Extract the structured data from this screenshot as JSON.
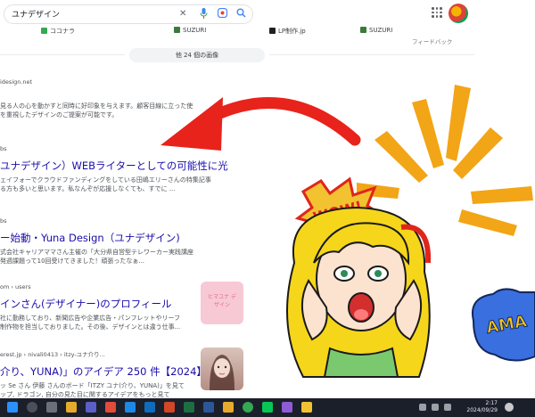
{
  "search": {
    "query": "ユナデザイン"
  },
  "chips": [
    {
      "label": "ココナラ",
      "color": "#34a853"
    },
    {
      "label": "SUZURI",
      "color": "#3c7a3c"
    },
    {
      "label": "LP制作.jp",
      "color": "#202124"
    },
    {
      "label": "SUZURI",
      "color": "#3c7a3c"
    }
  ],
  "feedback": "フィードバック",
  "more_images": "他 24 個の画像",
  "results": [
    {
      "cite": "idesign.net",
      "title": "",
      "snippet": [
        "見る人の心を動かすと同時に好印象を与えます。顧客目線に立った使",
        "を重視したデザインのご提案が可能です。"
      ]
    },
    {
      "cite": "bs",
      "title": "ユナデザイン）WEBライターとしての可能性に光",
      "snippet": [
        "ェイフォーでクラウドファンディングをしている田嶋エリーさんの特集記事",
        "る方も多いと思います。私なんぞが応援しなくても、すでに ..."
      ]
    },
    {
      "cite": "bs",
      "title": "ー始動・Yuna Design（ユナデザイン)",
      "snippet": [
        "式会社キャリアママさん主催の「大分県自営型テレワーカー実践講座",
        "発週課題って10回受けてきました！頑張ったなぁ..."
      ]
    },
    {
      "cite": "om › users",
      "title": "インさん(デザイナー)のプロフィール",
      "snippet": [
        "社に勤務しており、新聞広告や企業広告・パンフレットやリーフ",
        "制作物を担当しておりました。その後、デザインとは違う仕事..."
      ]
    },
    {
      "cite": "erest.jp › nivali0413 › itzy-ユナ介り...",
      "title": "介り、YUNA)」のアイデア 250 件【2024】",
      "snippet": [
        "ッ Se さん 伊藤 さんのボード「ITZY ユナ(介り、YUNA)」を見て",
        "ップ, ドラゴン, 自分の見た目に関するアイデアをもっと見て"
      ]
    }
  ],
  "thumb1_text": "ヒマユナ デザイン",
  "sticker_wow": "WOW!",
  "sticker_amaz": "AMA",
  "clock": {
    "time": "2:17",
    "date": "2024/09/29"
  },
  "colors": {
    "arrow": "#e8231b",
    "burst": "#f2a516",
    "hair": "#f5d61a"
  }
}
